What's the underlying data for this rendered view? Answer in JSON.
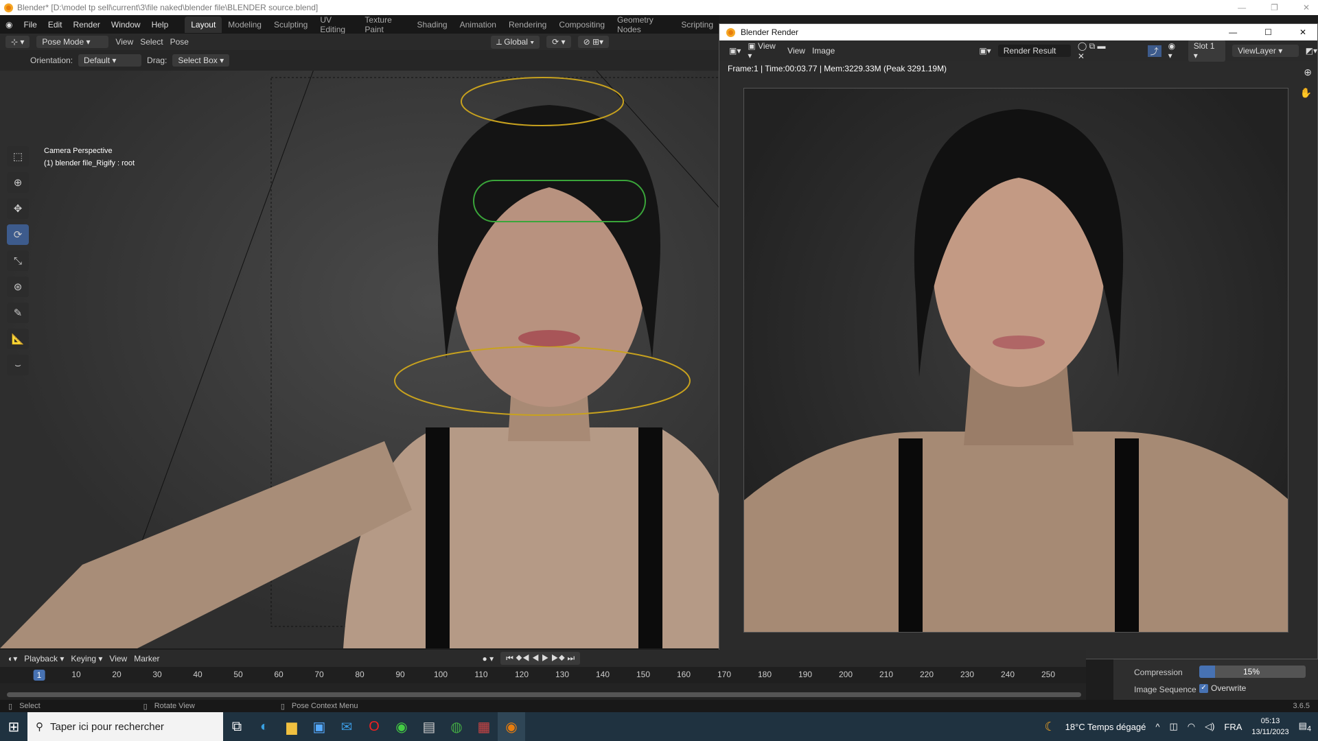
{
  "window_title": "Blender* [D:\\model tp sell\\current\\3\\file naked\\blender file\\BLENDER source.blend]",
  "menu": [
    "File",
    "Edit",
    "Render",
    "Window",
    "Help"
  ],
  "workspaces": [
    "Layout",
    "Modeling",
    "Sculpting",
    "UV Editing",
    "Texture Paint",
    "Shading",
    "Animation",
    "Rendering",
    "Compositing",
    "Geometry Nodes",
    "Scripting"
  ],
  "header": {
    "mode": "Pose Mode",
    "view": "View",
    "select": "Select",
    "pose": "Pose",
    "transform": "Global"
  },
  "toolsettings": {
    "orientation_label": "Orientation:",
    "orientation": "Default",
    "drag_label": "Drag:",
    "drag": "Select Box"
  },
  "viewport": {
    "camera": "Camera Perspective",
    "object": "(1) blender file_Rigify : root"
  },
  "render_window": {
    "title": "Blender Render",
    "view_menu": "View",
    "view": "View",
    "image": "Image",
    "image_name": "Render Result",
    "slot": "Slot 1",
    "layer": "ViewLayer",
    "info": "Frame:1 | Time:00:03.77 | Mem:3229.33M (Peak 3291.19M)"
  },
  "timeline": {
    "playback": "Playback",
    "keying": "Keying",
    "view": "View",
    "marker": "Marker",
    "current_frame": "1",
    "ticks": [
      "10",
      "20",
      "30",
      "40",
      "50",
      "60",
      "70",
      "80",
      "90",
      "100",
      "110",
      "120",
      "130",
      "140",
      "150",
      "160",
      "170",
      "180",
      "190",
      "200",
      "210",
      "220",
      "230",
      "240",
      "250"
    ]
  },
  "properties": {
    "compression_label": "Compression",
    "compression": "15%",
    "compression_value": 15,
    "sequence_label": "Image Sequence",
    "overwrite": "Overwrite",
    "overwrite_checked": true
  },
  "status": {
    "select": "Select",
    "rotate": "Rotate View",
    "context": "Pose Context Menu",
    "version": "3.6.5"
  },
  "taskbar": {
    "search": "Taper ici pour rechercher",
    "weather": "18°C  Temps dégagé",
    "lang": "FRA",
    "time": "05:13",
    "date": "13/11/2023",
    "notifications": "4"
  }
}
